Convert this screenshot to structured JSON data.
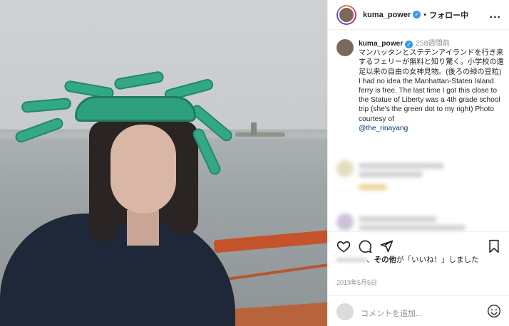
{
  "header": {
    "username": "kuma_power",
    "separator": "•",
    "follow_label": "フォロー中",
    "more_label": "..."
  },
  "caption": {
    "username": "kuma_power",
    "time_ago": "258週間前",
    "text_ja": "マンハッタンとステテンアイランドを行き来するフェリーが無料と知り驚く。小学校の遠足以来の自由の女神見物。(後ろの緑の豆粒)",
    "text_en": "I had no idea the Manhattan-Staten Island ferry is free. The last time I got this close to the Statue of Liberty was a 4th grade school trip (she's the green dot to my right) Photo courtesy of",
    "mention": "@the_rinayang"
  },
  "likes": {
    "blurred_name": "xxxxxxxx",
    "text_middle": "その他",
    "text_end": "が「いいね！」しました"
  },
  "date": "2019年5月5日",
  "comment": {
    "placeholder": "コメントを追加..."
  },
  "icons": [
    "heart-icon",
    "comment-icon",
    "share-icon",
    "bookmark-icon",
    "emoji-icon",
    "more-icon",
    "verified-icon"
  ],
  "colors": {
    "verified": "#3897f0",
    "mention": "#00376b",
    "muted": "#8e8e8e"
  }
}
